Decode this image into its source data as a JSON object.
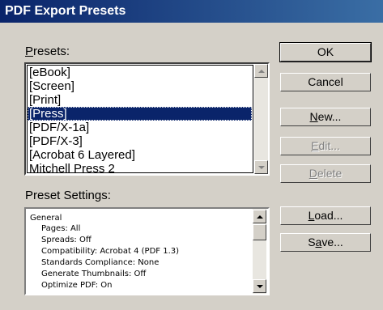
{
  "window": {
    "title": "PDF Export Presets"
  },
  "presets": {
    "label": "Presets:",
    "items": [
      "[eBook]",
      "[Screen]",
      "[Print]",
      "[Press]",
      "[PDF/X-1a]",
      "[PDF/X-3]",
      "[Acrobat 6 Layered]",
      "Mitchell Press 2"
    ],
    "selected": "[Press]"
  },
  "settings": {
    "label": "Preset Settings:",
    "lines": [
      "General",
      "Pages: All",
      "Spreads: Off",
      "Compatibility: Acrobat 4 (PDF 1.3)",
      "Standards Compliance: None",
      "Generate Thumbnails: Off",
      "Optimize PDF: On"
    ]
  },
  "buttons": {
    "ok": "OK",
    "cancel": "Cancel",
    "new": "New...",
    "edit": "Edit...",
    "delete": "Delete",
    "load": "Load...",
    "save": "Save..."
  },
  "icons": {
    "scroll_up": "triangle-up-icon",
    "scroll_down": "triangle-down-icon"
  }
}
